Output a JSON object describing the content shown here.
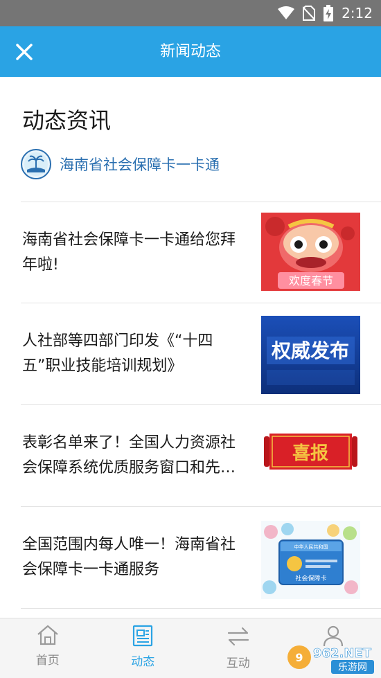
{
  "status_bar": {
    "time": "2:12"
  },
  "header": {
    "title": "新闻动态",
    "close_icon": "close-icon"
  },
  "section": {
    "title": "动态资讯",
    "source_name": "海南省社会保障卡一卡通"
  },
  "news": [
    {
      "title": "海南省社会保障卡一卡通给您拜年啦!",
      "thumb_text": "欢度春节"
    },
    {
      "title": "人社部等四部门印发《“十四五”职业技能培训规划》",
      "thumb_text": "权威发布"
    },
    {
      "title": "表彰名单来了！全国人力资源社会保障系统优质服务窗口和先进个人",
      "thumb_text": "喜报"
    },
    {
      "title": "全国范围内每人唯一！海南省社会保障卡一卡通服务",
      "thumb_text": "社会保障卡",
      "thumb_subtext": "中华人民共和国"
    }
  ],
  "tabs": [
    {
      "label": "首页",
      "icon": "home-icon",
      "active": false
    },
    {
      "label": "动态",
      "icon": "news-icon",
      "active": true
    },
    {
      "label": "互动",
      "icon": "exchange-icon",
      "active": false
    },
    {
      "label": "",
      "icon": "user-icon",
      "active": false
    }
  ],
  "watermark": {
    "brand": "962.NET",
    "sub": "乐游网"
  },
  "colors": {
    "accent": "#2aa3e4",
    "status_bar": "#757575",
    "link": "#2a6fb0"
  }
}
